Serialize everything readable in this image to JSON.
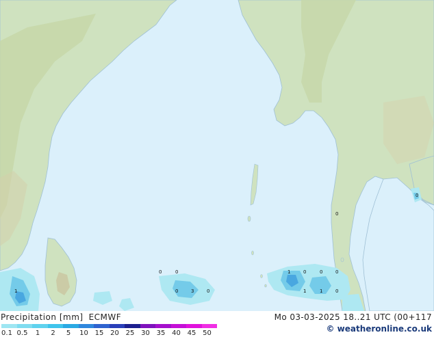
{
  "map": {
    "precip_labels": [
      "1",
      "0",
      "0",
      "0",
      "3",
      "0",
      "1",
      "0",
      "0",
      "0",
      "1",
      "1",
      "0",
      "0",
      "0"
    ],
    "colors": {
      "sea": "#dbf0fb",
      "land": "#cfe2bf",
      "land_dark": "#b3cf9e",
      "hills": "#c9c7a5",
      "light_rain": "#aee8f2",
      "rain": "#74cbe9",
      "heavy_rain": "#49a7e0"
    }
  },
  "footer": {
    "title": "Precipitation [mm]",
    "model": "ECMWF",
    "time": "Mo 03-03-2025 18..21 UTC (00+117",
    "credit": "© weatheronline.co.uk"
  },
  "legend": {
    "ticks": [
      "0.1",
      "0.5",
      "1",
      "2",
      "5",
      "10",
      "15",
      "20",
      "25",
      "30",
      "35",
      "40",
      "45",
      "50"
    ],
    "colors": [
      "#9ee6f2",
      "#7fdcf0",
      "#5fd2ee",
      "#3fc4ec",
      "#2aa9e3",
      "#2f87dd",
      "#2f63cf",
      "#2a3fb9",
      "#1c1f8e",
      "#7f12bd",
      "#a50fcc",
      "#c50fd7",
      "#e012dc",
      "#f02ee4"
    ]
  }
}
